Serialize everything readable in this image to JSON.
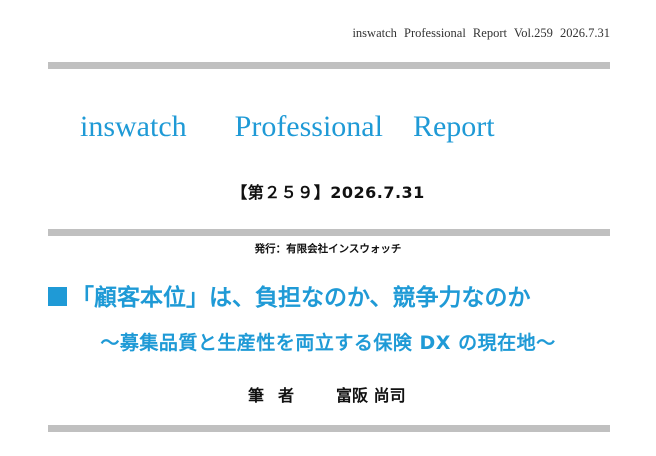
{
  "header": {
    "running_head": "inswatch  Professional  Report  Vol.259     2026.7.31"
  },
  "masthead": {
    "word1": "inswatch",
    "word2": "Professional",
    "word3": "Report",
    "color": "#1f9ad6"
  },
  "issue": {
    "label": "【第２５９】2026.7.31"
  },
  "publisher": {
    "text": "発行：有限会社インスウォッチ"
  },
  "article": {
    "title": "「顧客本位」は、負担なのか、競争力なのか",
    "subtitle": "～募集品質と生産性を両立する保険 DX の現在地～",
    "title_icon": "square-icon"
  },
  "author": {
    "label": "筆者",
    "name": "富阪 尚司"
  }
}
